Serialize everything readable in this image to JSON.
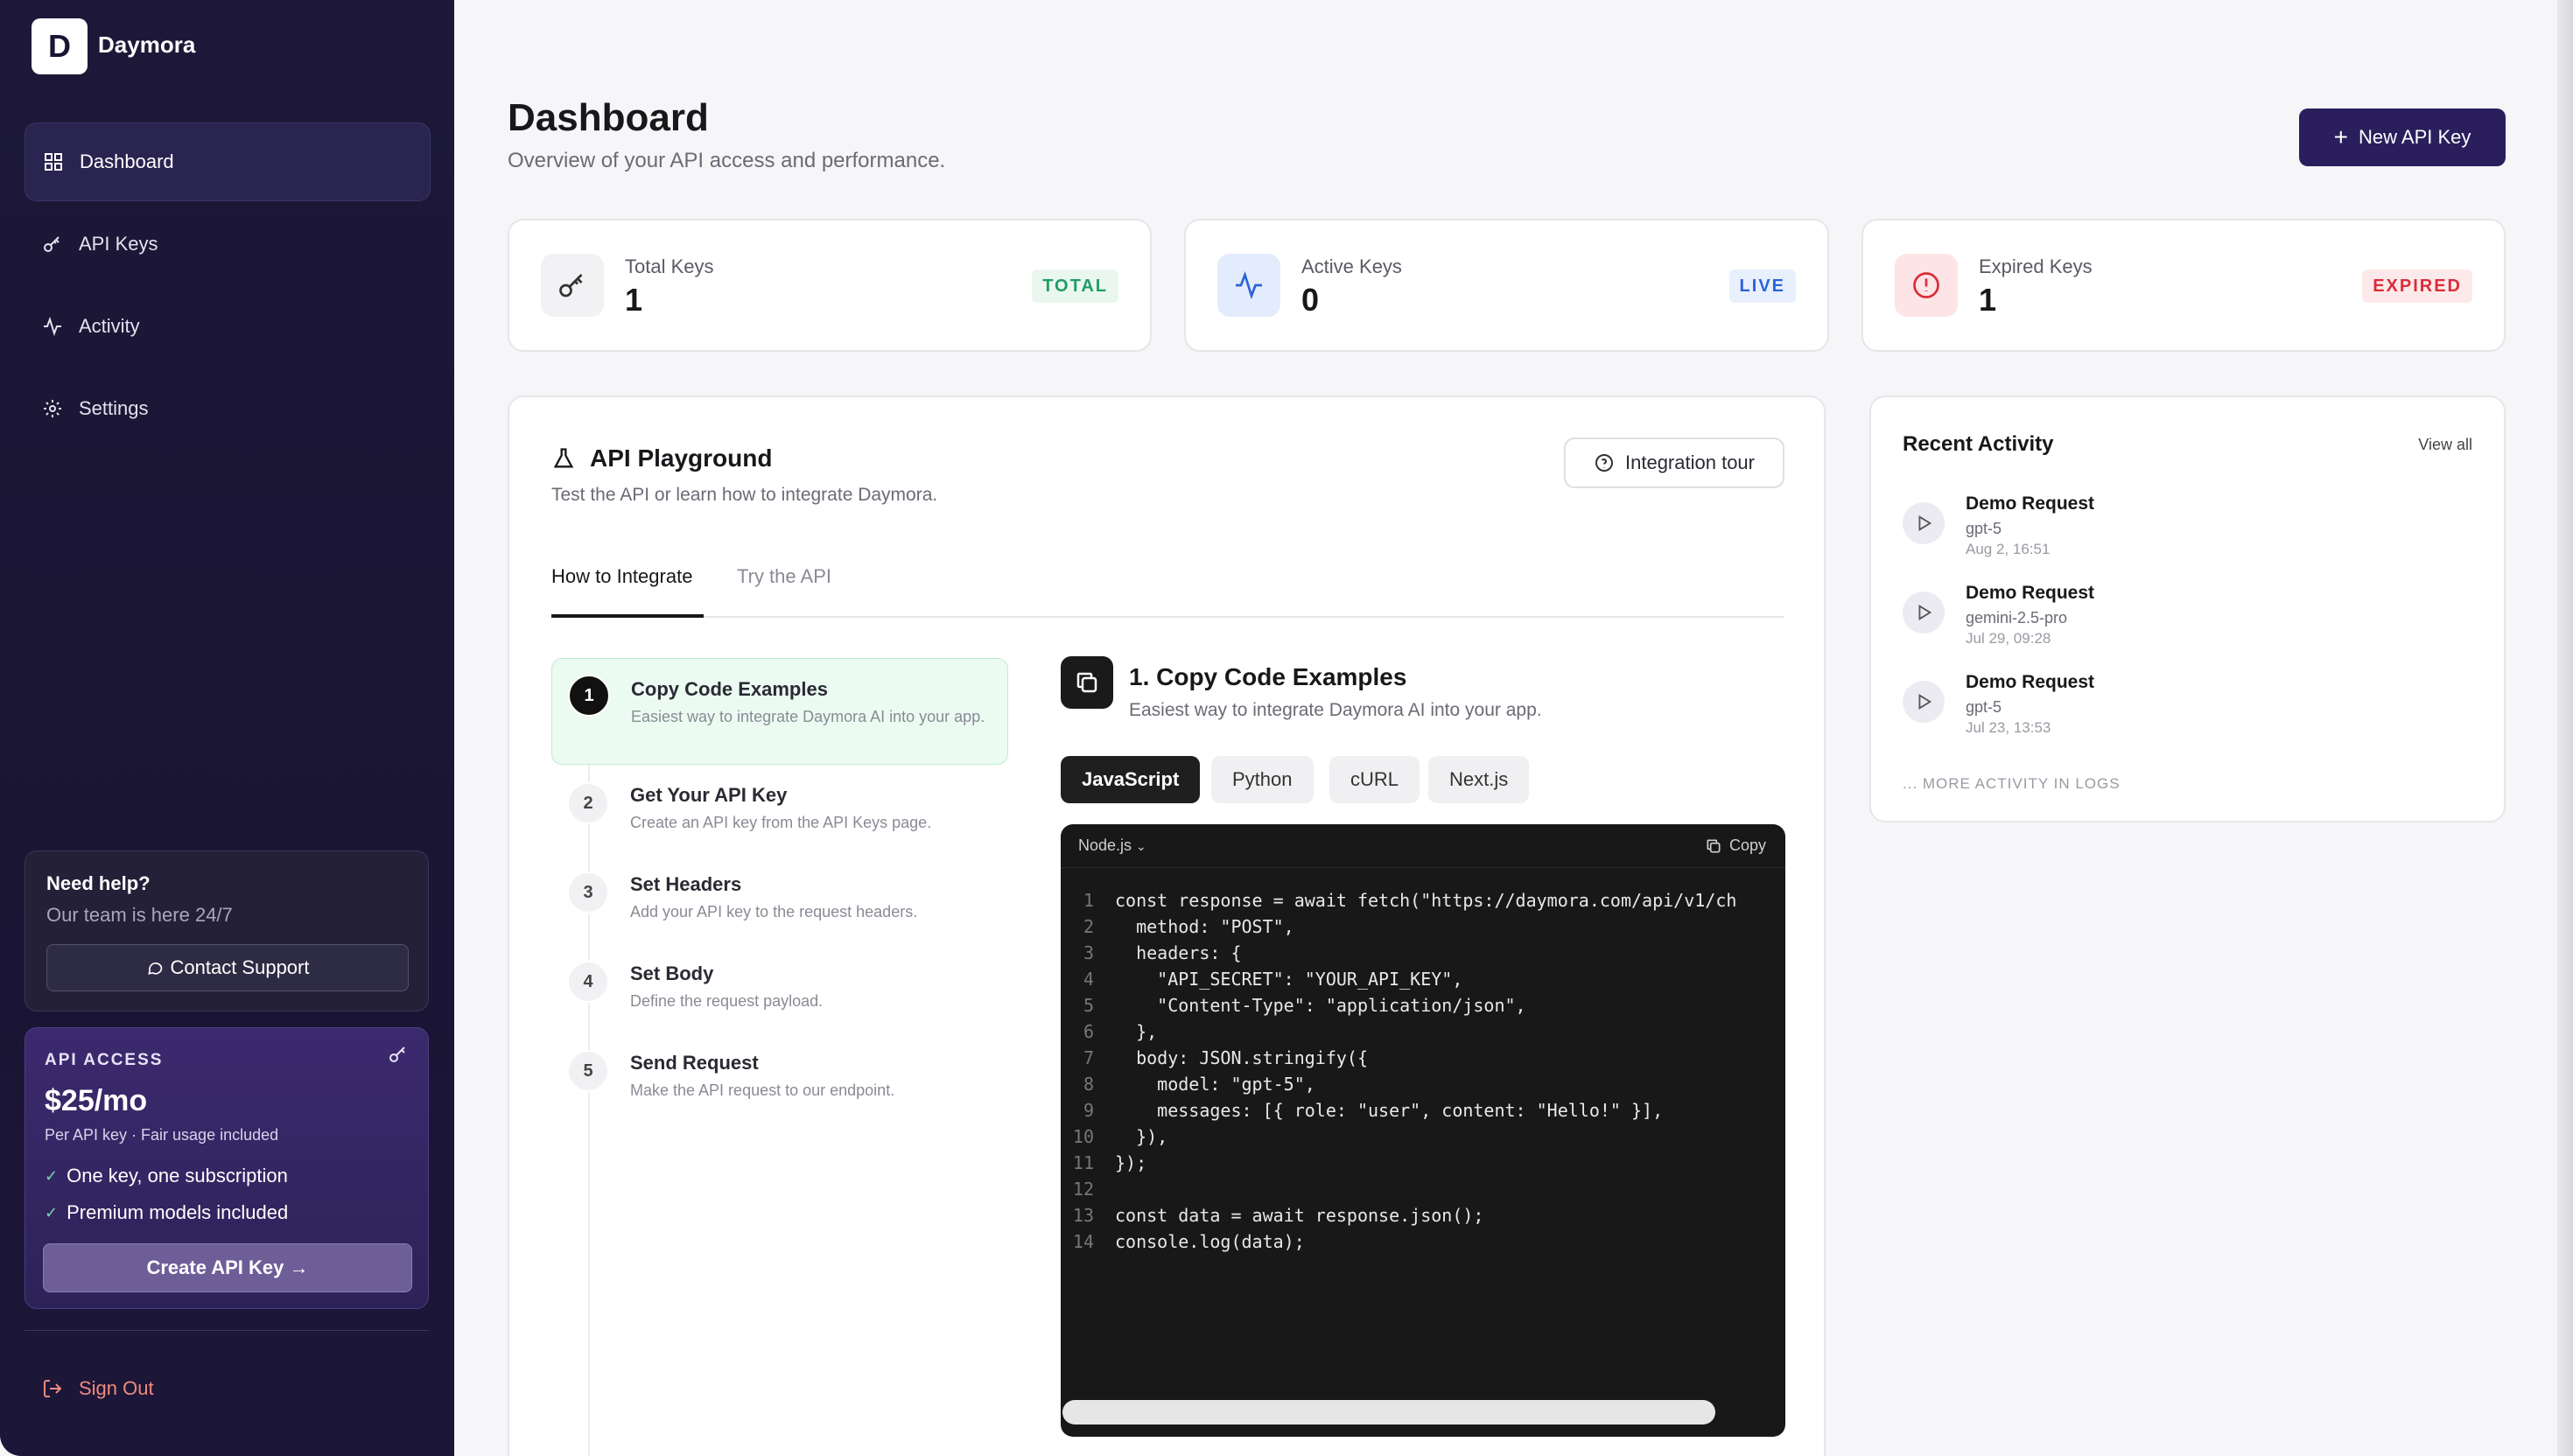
{
  "brand": {
    "letter": "D",
    "name": "Daymora"
  },
  "nav": [
    {
      "label": "Dashboard",
      "icon": "dashboard-icon",
      "active": true
    },
    {
      "label": "API Keys",
      "icon": "key-icon"
    },
    {
      "label": "Activity",
      "icon": "activity-icon"
    },
    {
      "label": "Settings",
      "icon": "gear-icon"
    }
  ],
  "help": {
    "title": "Need help?",
    "sub": "Our team is here 24/7",
    "button": "Contact Support"
  },
  "access": {
    "label": "API ACCESS",
    "price": "$25/mo",
    "sub": "Per API key · Fair usage included",
    "features": [
      "One key, one subscription",
      "Premium models included"
    ],
    "button": "Create API Key →"
  },
  "signout": "Sign Out",
  "page": {
    "title": "Dashboard",
    "subtitle": "Overview of your API access and performance.",
    "new_key": "New API Key"
  },
  "stats": [
    {
      "label": "Total Keys",
      "value": "1",
      "badge": "TOTAL",
      "color": "#1f9d63"
    },
    {
      "label": "Active Keys",
      "value": "0",
      "badge": "LIVE",
      "color": "#2b63d9"
    },
    {
      "label": "Expired Keys",
      "value": "1",
      "badge": "EXPIRED",
      "color": "#d92d3a"
    }
  ],
  "playground": {
    "title": "API Playground",
    "sub": "Test the API or learn how to integrate Daymora.",
    "tour": "Integration tour",
    "tabs": [
      "How to Integrate",
      "Try the API"
    ],
    "steps": [
      {
        "num": "1",
        "title": "Copy Code Examples",
        "desc": "Easiest way to integrate Daymora AI into your app."
      },
      {
        "num": "2",
        "title": "Get Your API Key",
        "desc": "Create an API key from the API Keys page."
      },
      {
        "num": "3",
        "title": "Set Headers",
        "desc": "Add your API key to the request headers."
      },
      {
        "num": "4",
        "title": "Set Body",
        "desc": "Define the request payload."
      },
      {
        "num": "5",
        "title": "Send Request",
        "desc": "Make the API request to our endpoint."
      }
    ],
    "section_title": "1. Copy Code Examples",
    "section_sub": "Easiest way to integrate Daymora AI into your app.",
    "langs": [
      "JavaScript",
      "Python",
      "cURL",
      "Next.js"
    ],
    "code_lang": "Node.js",
    "copy": "Copy",
    "code": [
      "const response = await fetch(\"https://daymora.com/api/v1/ch",
      "  method: \"POST\",",
      "  headers: {",
      "    \"API_SECRET\": \"YOUR_API_KEY\",",
      "    \"Content-Type\": \"application/json\",",
      "  },",
      "  body: JSON.stringify({",
      "    model: \"gpt-5\",",
      "    messages: [{ role: \"user\", content: \"Hello!\" }],",
      "  }),",
      "});",
      "",
      "const data = await response.json();",
      "console.log(data);"
    ]
  },
  "recent": {
    "title": "Recent Activity",
    "view_all": "View all",
    "items": [
      {
        "name": "Demo Request",
        "model": "gpt-5",
        "time": "Aug 2, 16:51"
      },
      {
        "name": "Demo Request",
        "model": "gemini-2.5-pro",
        "time": "Jul 29, 09:28"
      },
      {
        "name": "Demo Request",
        "model": "gpt-5",
        "time": "Jul 23, 13:53"
      }
    ],
    "more": "... MORE ACTIVITY IN LOGS"
  }
}
